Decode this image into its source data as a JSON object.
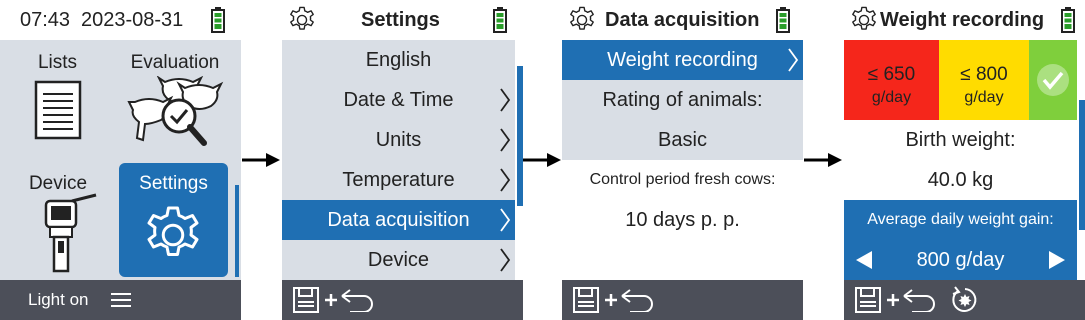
{
  "colors": {
    "accent_blue": "#1f6fb3",
    "panel_gray": "#d9dee5",
    "footer_dark": "#4c4f59",
    "battery_green": "#2a9d2a",
    "limit_red": "#f5261b",
    "limit_yellow": "#ffdc00",
    "limit_green": "#7fcf3c"
  },
  "screen1": {
    "header": {
      "time": "07:43",
      "date": "2023-08-31",
      "battery_icon": "battery-full-icon"
    },
    "tiles": [
      {
        "label": "Lists",
        "icon": "list-document-icon"
      },
      {
        "label": "Evaluation",
        "icon": "cow-check-icon"
      },
      {
        "label": "Device",
        "icon": "handheld-device-icon"
      },
      {
        "label": "Settings",
        "icon": "gear-icon"
      }
    ],
    "footer": {
      "light_label": "Light on",
      "menu_icon": "hamburger-icon"
    }
  },
  "screen2": {
    "title": "Settings",
    "items": [
      "English",
      "Date & Time",
      "Units",
      "Temperature",
      "Data acquisition",
      "Device"
    ],
    "selected_index": 4,
    "footer": {
      "icons": [
        "save-icon",
        "plus-icon",
        "back-arrow-icon"
      ]
    }
  },
  "screen3": {
    "title": "Data acquisition",
    "items": [
      {
        "label": "Weight recording"
      },
      {
        "label": "Rating of animals:"
      },
      {
        "label": "Basic"
      },
      {
        "label": "Control period fresh cows:"
      },
      {
        "label": "10 days p. p."
      }
    ],
    "footer": {
      "icons": [
        "save-icon",
        "plus-icon",
        "back-arrow-icon"
      ]
    }
  },
  "screen4": {
    "title": "Weight recording",
    "limits": [
      {
        "line1": "≤ 650",
        "line2": "g/day",
        "color": "#f5261b"
      },
      {
        "line1": "≤ 800",
        "line2": "g/day",
        "color": "#ffdc00"
      },
      {
        "icon": "check-circle-icon",
        "color": "#7fcf3c"
      }
    ],
    "birth_weight_label": "Birth weight:",
    "birth_weight_value": "40.0 kg",
    "adg_label": "Average daily weight gain:",
    "adg_value": "800 g/day",
    "footer": {
      "icons": [
        "save-icon",
        "plus-icon",
        "back-arrow-icon",
        "reset-icon"
      ]
    }
  },
  "connectors": [
    "arrow-right-icon",
    "arrow-right-icon",
    "arrow-right-icon"
  ]
}
